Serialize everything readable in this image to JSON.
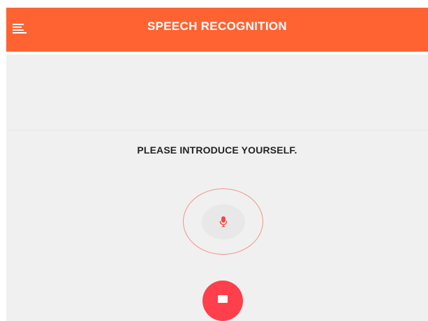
{
  "header": {
    "title": "SPEECH RECOGNITION",
    "menu_icon": "menu-lines-icon",
    "background_color": "#ff6332"
  },
  "main": {
    "prompt": "PLEASE INTRODUCE YOURSELF.",
    "mic_icon": "microphone-icon",
    "stop_icon": "stop-square-icon",
    "accent_color": "#ff3f4c",
    "ring_color": "#ef948d"
  }
}
